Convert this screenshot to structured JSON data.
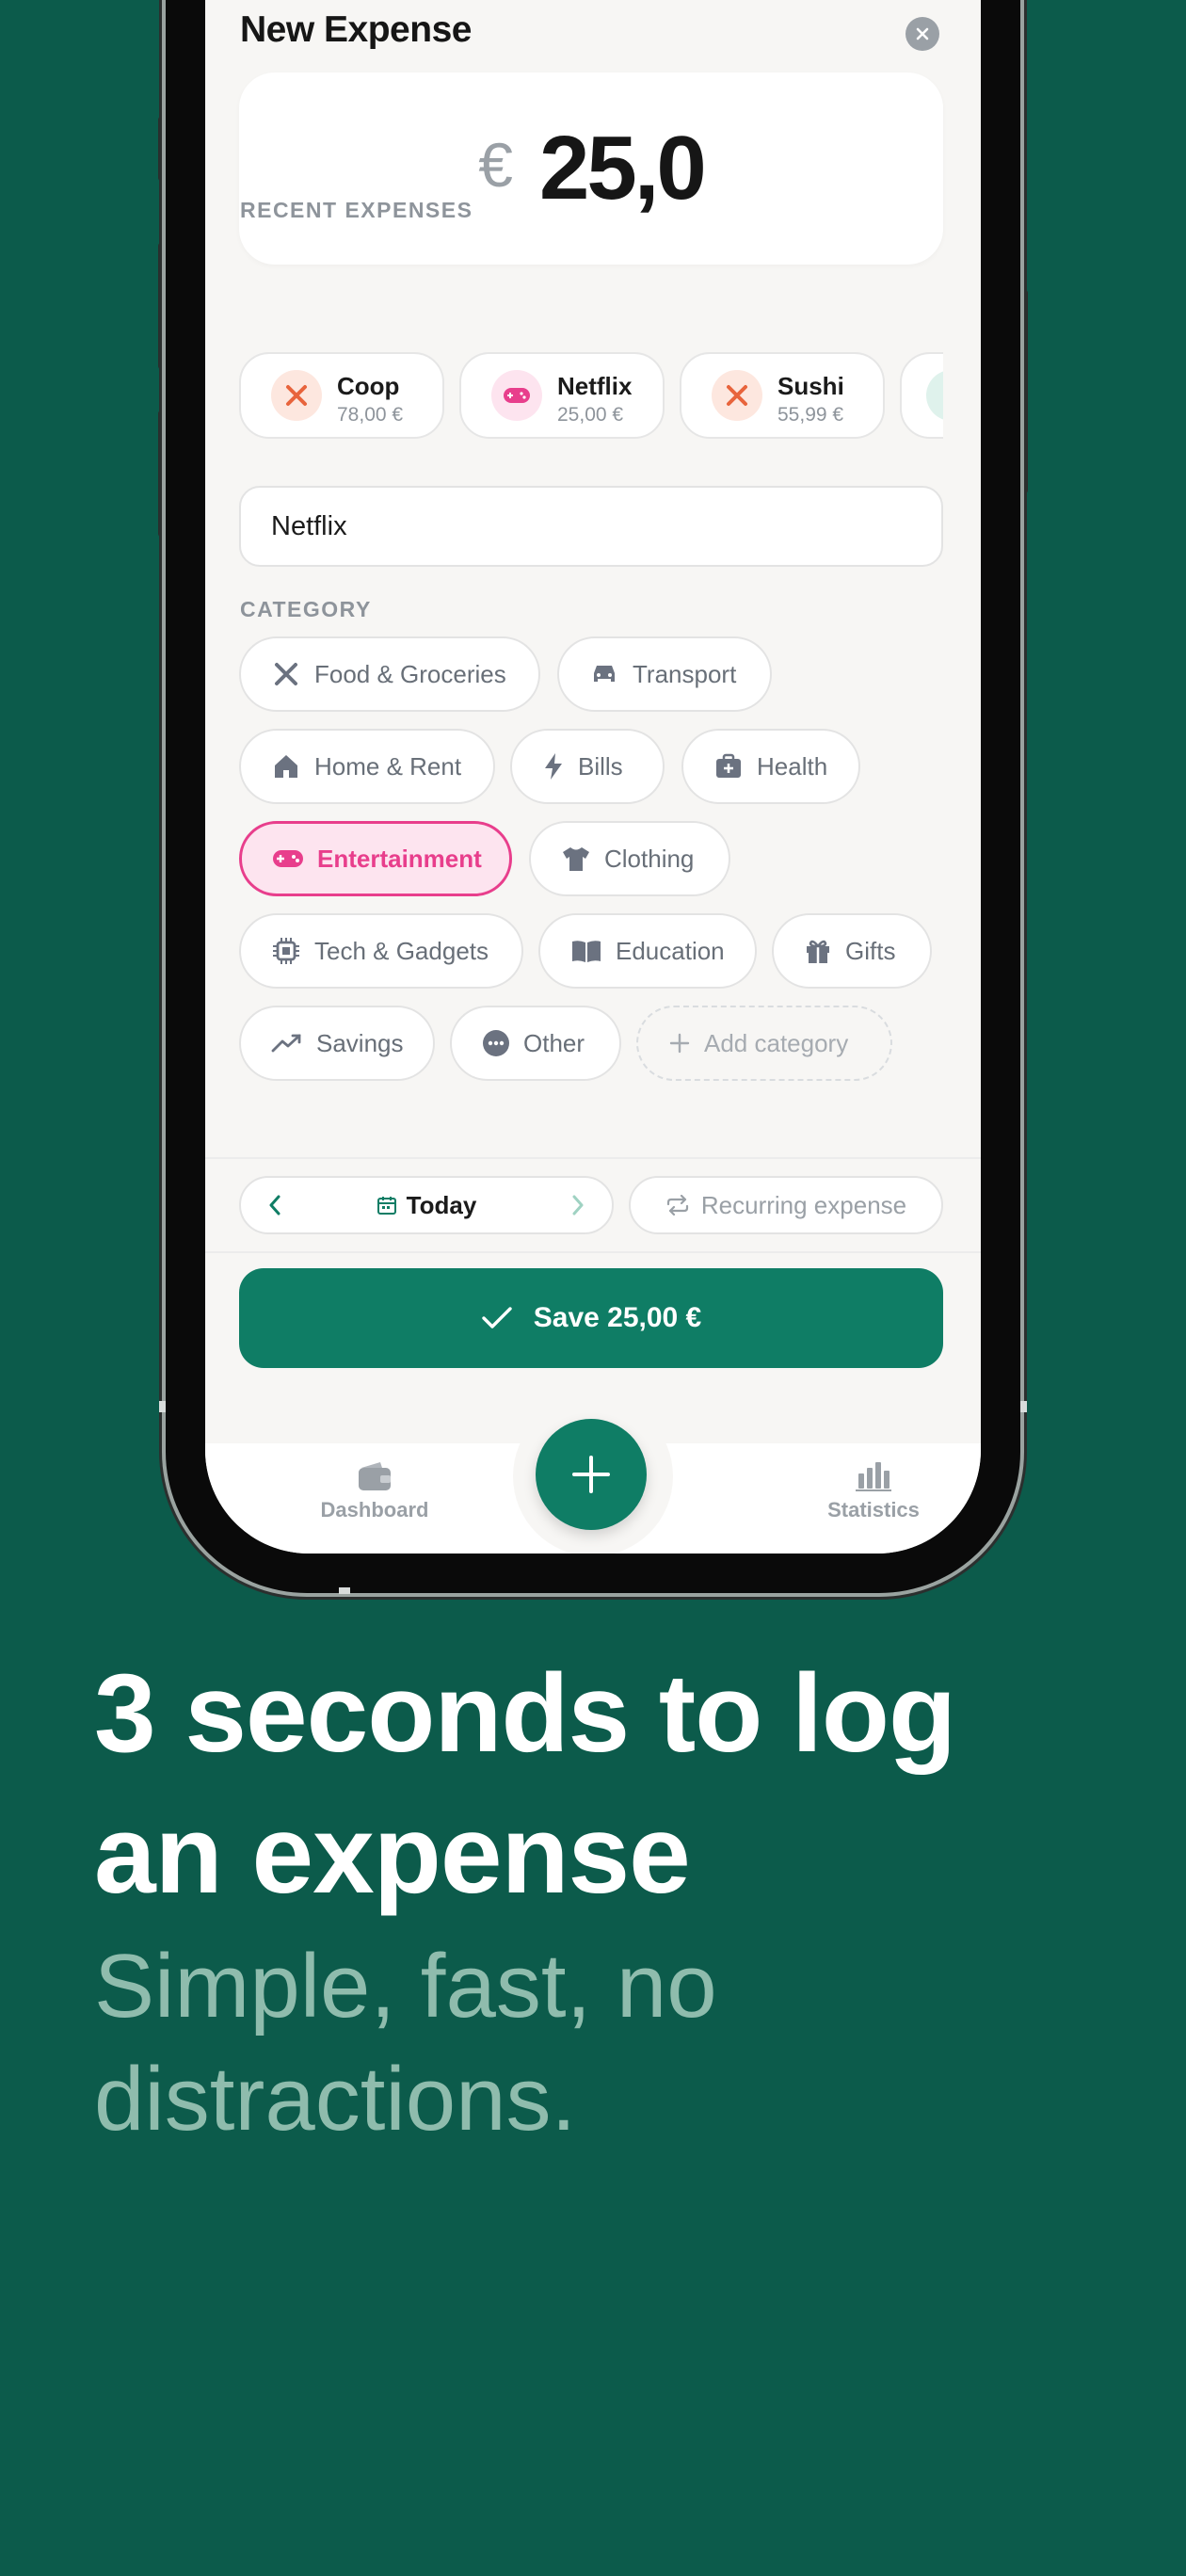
{
  "sheet": {
    "title": "New Expense",
    "currency_symbol": "€",
    "amount": "25,0"
  },
  "recent": {
    "label": "RECENT EXPENSES",
    "items": [
      {
        "name": "Coop",
        "price": "78,00 €",
        "icon": "utensils-icon",
        "color": "#e8643c"
      },
      {
        "name": "Netflix",
        "price": "25,00 €",
        "icon": "gamepad-icon",
        "color": "#e83e8c"
      },
      {
        "name": "Sushi",
        "price": "55,99 €",
        "icon": "utensils-icon",
        "color": "#e8643c"
      }
    ]
  },
  "description": {
    "value": "Netflix"
  },
  "category": {
    "label": "CATEGORY",
    "items": [
      {
        "label": "Food & Groceries",
        "icon": "utensils-icon"
      },
      {
        "label": "Transport",
        "icon": "car-icon"
      },
      {
        "label": "Home & Rent",
        "icon": "home-icon"
      },
      {
        "label": "Bills",
        "icon": "bolt-icon"
      },
      {
        "label": "Health",
        "icon": "medical-kit-icon"
      },
      {
        "label": "Entertainment",
        "icon": "gamepad-icon",
        "selected": true
      },
      {
        "label": "Clothing",
        "icon": "shirt-icon"
      },
      {
        "label": "Tech & Gadgets",
        "icon": "chip-icon"
      },
      {
        "label": "Education",
        "icon": "book-icon"
      },
      {
        "label": "Gifts",
        "icon": "gift-icon"
      },
      {
        "label": "Savings",
        "icon": "trend-up-icon"
      },
      {
        "label": "Other",
        "icon": "dots-icon"
      }
    ],
    "add_label": "Add category"
  },
  "date": {
    "label": "Today"
  },
  "recurring": {
    "label": "Recurring expense"
  },
  "save": {
    "label": "Save 25,00 €"
  },
  "tabbar": {
    "left": "Dashboard",
    "right": "Statistics"
  },
  "marketing": {
    "headline_line1": "3 seconds to log",
    "headline_line2": "an expense",
    "sub_line1": "Simple, fast, no",
    "sub_line2": "distractions."
  },
  "colors": {
    "background": "#0c5b4b",
    "accent": "#0f7d65",
    "selected": "#e83e8c",
    "headline": "#ffffff",
    "subline": "#8fbcad"
  }
}
